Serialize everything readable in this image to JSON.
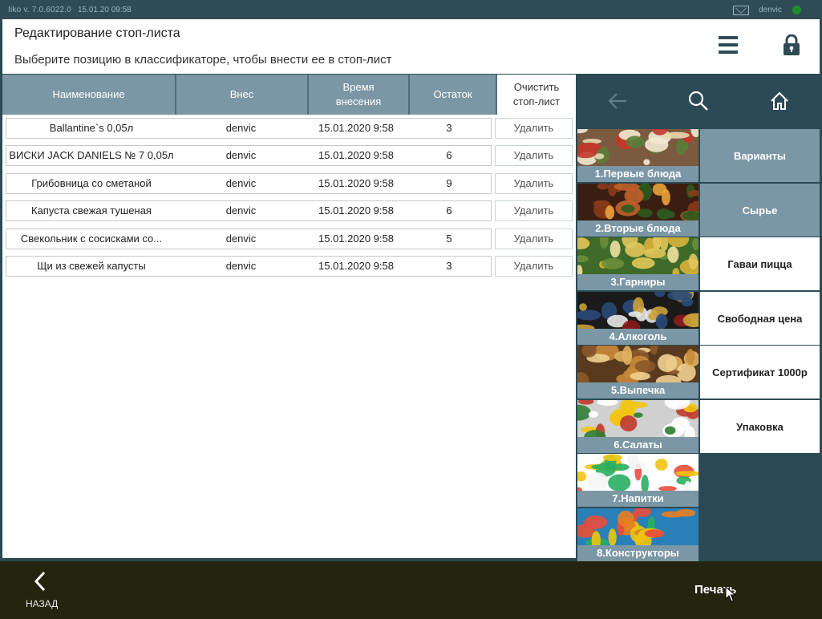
{
  "titlebar": {
    "version": "Iiko  v. 7.0.6022.0",
    "datetime": "15.01.20   09:58",
    "user": "denvic"
  },
  "header": {
    "title": "Редактирование стоп-листа",
    "subtitle": "Выберите позицию в классификаторе, чтобы внести ее в стоп-лист"
  },
  "table": {
    "columns": {
      "name": "Наименование",
      "by": "Внес",
      "time": "Время внесения",
      "rest": "Остаток",
      "clear": "Очистить стоп-лист"
    },
    "delete_label": "Удалить",
    "rows": [
      {
        "name": "Ballantine`s 0,05л",
        "by": "denvic",
        "time": "15.01.2020 9:58",
        "rest": "3"
      },
      {
        "name": "ВИСКИ JACK DANIELS № 7 0,05л",
        "by": "denvic",
        "time": "15.01.2020 9:58",
        "rest": "6"
      },
      {
        "name": "Грибовница со сметаной",
        "by": "denvic",
        "time": "15.01.2020 9:58",
        "rest": "9"
      },
      {
        "name": "Капуста свежая тушеная",
        "by": "denvic",
        "time": "15.01.2020 9:58",
        "rest": "6"
      },
      {
        "name": "Свекольник с сосисками со...",
        "by": "denvic",
        "time": "15.01.2020 9:58",
        "rest": "5"
      },
      {
        "name": "Щи из свежей капусты",
        "by": "denvic",
        "time": "15.01.2020 9:58",
        "rest": "3"
      }
    ]
  },
  "nav": {
    "icons": [
      "arrow-left-icon",
      "search-icon",
      "home-icon"
    ]
  },
  "categories": [
    {
      "label": "1.Первые блюда"
    },
    {
      "label": "2.Вторые блюда"
    },
    {
      "label": "3.Гарниры"
    },
    {
      "label": "4.Алкоголь"
    },
    {
      "label": "5.Выпечка"
    },
    {
      "label": "6.Салаты"
    },
    {
      "label": "7.Напитки"
    },
    {
      "label": "8.Конструкторы"
    }
  ],
  "side_tiles": [
    {
      "label": "Варианты"
    },
    {
      "label": "Сырье"
    },
    {
      "label": "Гаваи пицца"
    },
    {
      "label": "Свободная цена"
    },
    {
      "label": "Сертификат 1000р"
    },
    {
      "label": "Упаковка"
    }
  ],
  "footer": {
    "back_label": "НАЗАД",
    "print_label": "Печать"
  },
  "colors": {
    "background": "#2b4a55",
    "header_cells": "#7b97a5",
    "footer": "#25250f",
    "status_online": "#1e8f2a"
  }
}
